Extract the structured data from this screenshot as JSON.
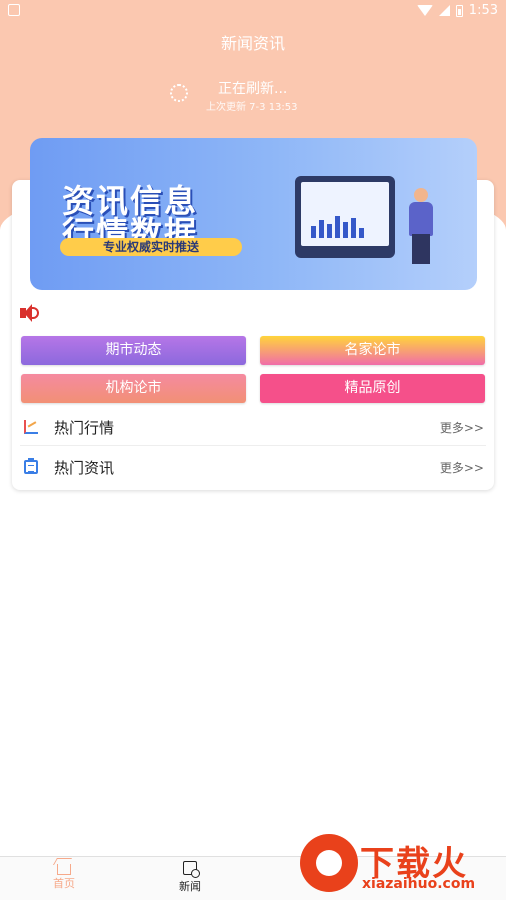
{
  "status_bar": {
    "time": "1:53"
  },
  "header": {
    "title": "新闻资讯"
  },
  "refresh": {
    "title": "正在刷新...",
    "last_updated": "上次更新 7-3 13:53"
  },
  "banner": {
    "line1": "资讯信息",
    "line2": "行情数据",
    "pill": "专业权威实时推送"
  },
  "categories": [
    {
      "label": "期市动态"
    },
    {
      "label": "名家论市"
    },
    {
      "label": "机构论市"
    },
    {
      "label": "精品原创"
    }
  ],
  "sections": [
    {
      "label": "热门行情",
      "more": "更多>>"
    },
    {
      "label": "热门资讯",
      "more": "更多>>"
    }
  ],
  "tabbar": {
    "tabs": [
      {
        "label": "首页"
      },
      {
        "label": "新闻"
      }
    ]
  },
  "watermark": {
    "text": "下载火",
    "sub": "xiazaihuo.com"
  },
  "colors": {
    "header_bg": "#fbc8b0",
    "accent_red": "#d9312d",
    "tab_active": "#222222",
    "tab_inactive": "#f6a98a"
  }
}
